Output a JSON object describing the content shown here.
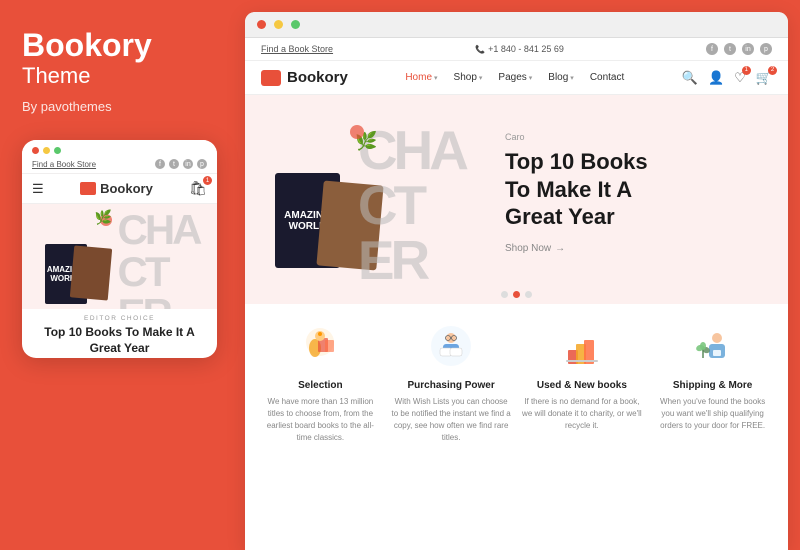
{
  "left": {
    "brand": "Bookory",
    "theme_label": "Theme",
    "by_label": "By pavothemes",
    "mobile": {
      "find_store": "Find a Book Store",
      "logo": "Bookory",
      "editor_label": "EDITOR CHOICE",
      "editor_title": "Top 10 Books To Make It A Great Year",
      "cart_count": "1"
    }
  },
  "browser": {
    "dots": [
      "red",
      "yellow",
      "green"
    ]
  },
  "site": {
    "top_bar": {
      "find_store": "Find a Book Store",
      "phone": "+1 840 - 841 25 69"
    },
    "header": {
      "logo": "Bookory",
      "nav": [
        {
          "label": "Home",
          "active": true,
          "has_dropdown": true
        },
        {
          "label": "Shop",
          "active": false,
          "has_dropdown": true
        },
        {
          "label": "Pages",
          "active": false,
          "has_dropdown": true
        },
        {
          "label": "Blog",
          "active": false,
          "has_dropdown": true
        },
        {
          "label": "Contact",
          "active": false,
          "has_dropdown": false
        }
      ]
    },
    "hero": {
      "badge": "Caro",
      "title": "Top 10 Books\nTo Make It A\nGreat Year",
      "shop_now": "Shop Now"
    },
    "features": [
      {
        "id": "selection",
        "title": "Selection",
        "desc": "We have more than 13 million titles to choose from, from the earliest board books to the all-time classics.",
        "icon_color": "#f5a623"
      },
      {
        "id": "purchasing-power",
        "title": "Purchasing Power",
        "desc": "With Wish Lists you can choose to be notified the instant we find a copy, see how often we find rare titles.",
        "icon_color": "#4a90d9"
      },
      {
        "id": "used-new-books",
        "title": "Used & New books",
        "desc": "If there is no demand for a book, we will donate it to charity, or we'll recycle it.",
        "icon_color": "#e8503a"
      },
      {
        "id": "shipping-more",
        "title": "Shipping & More",
        "desc": "When you've found the books you want we'll ship qualifying orders to your door for FREE.",
        "icon_color": "#5a9fd4"
      }
    ]
  }
}
